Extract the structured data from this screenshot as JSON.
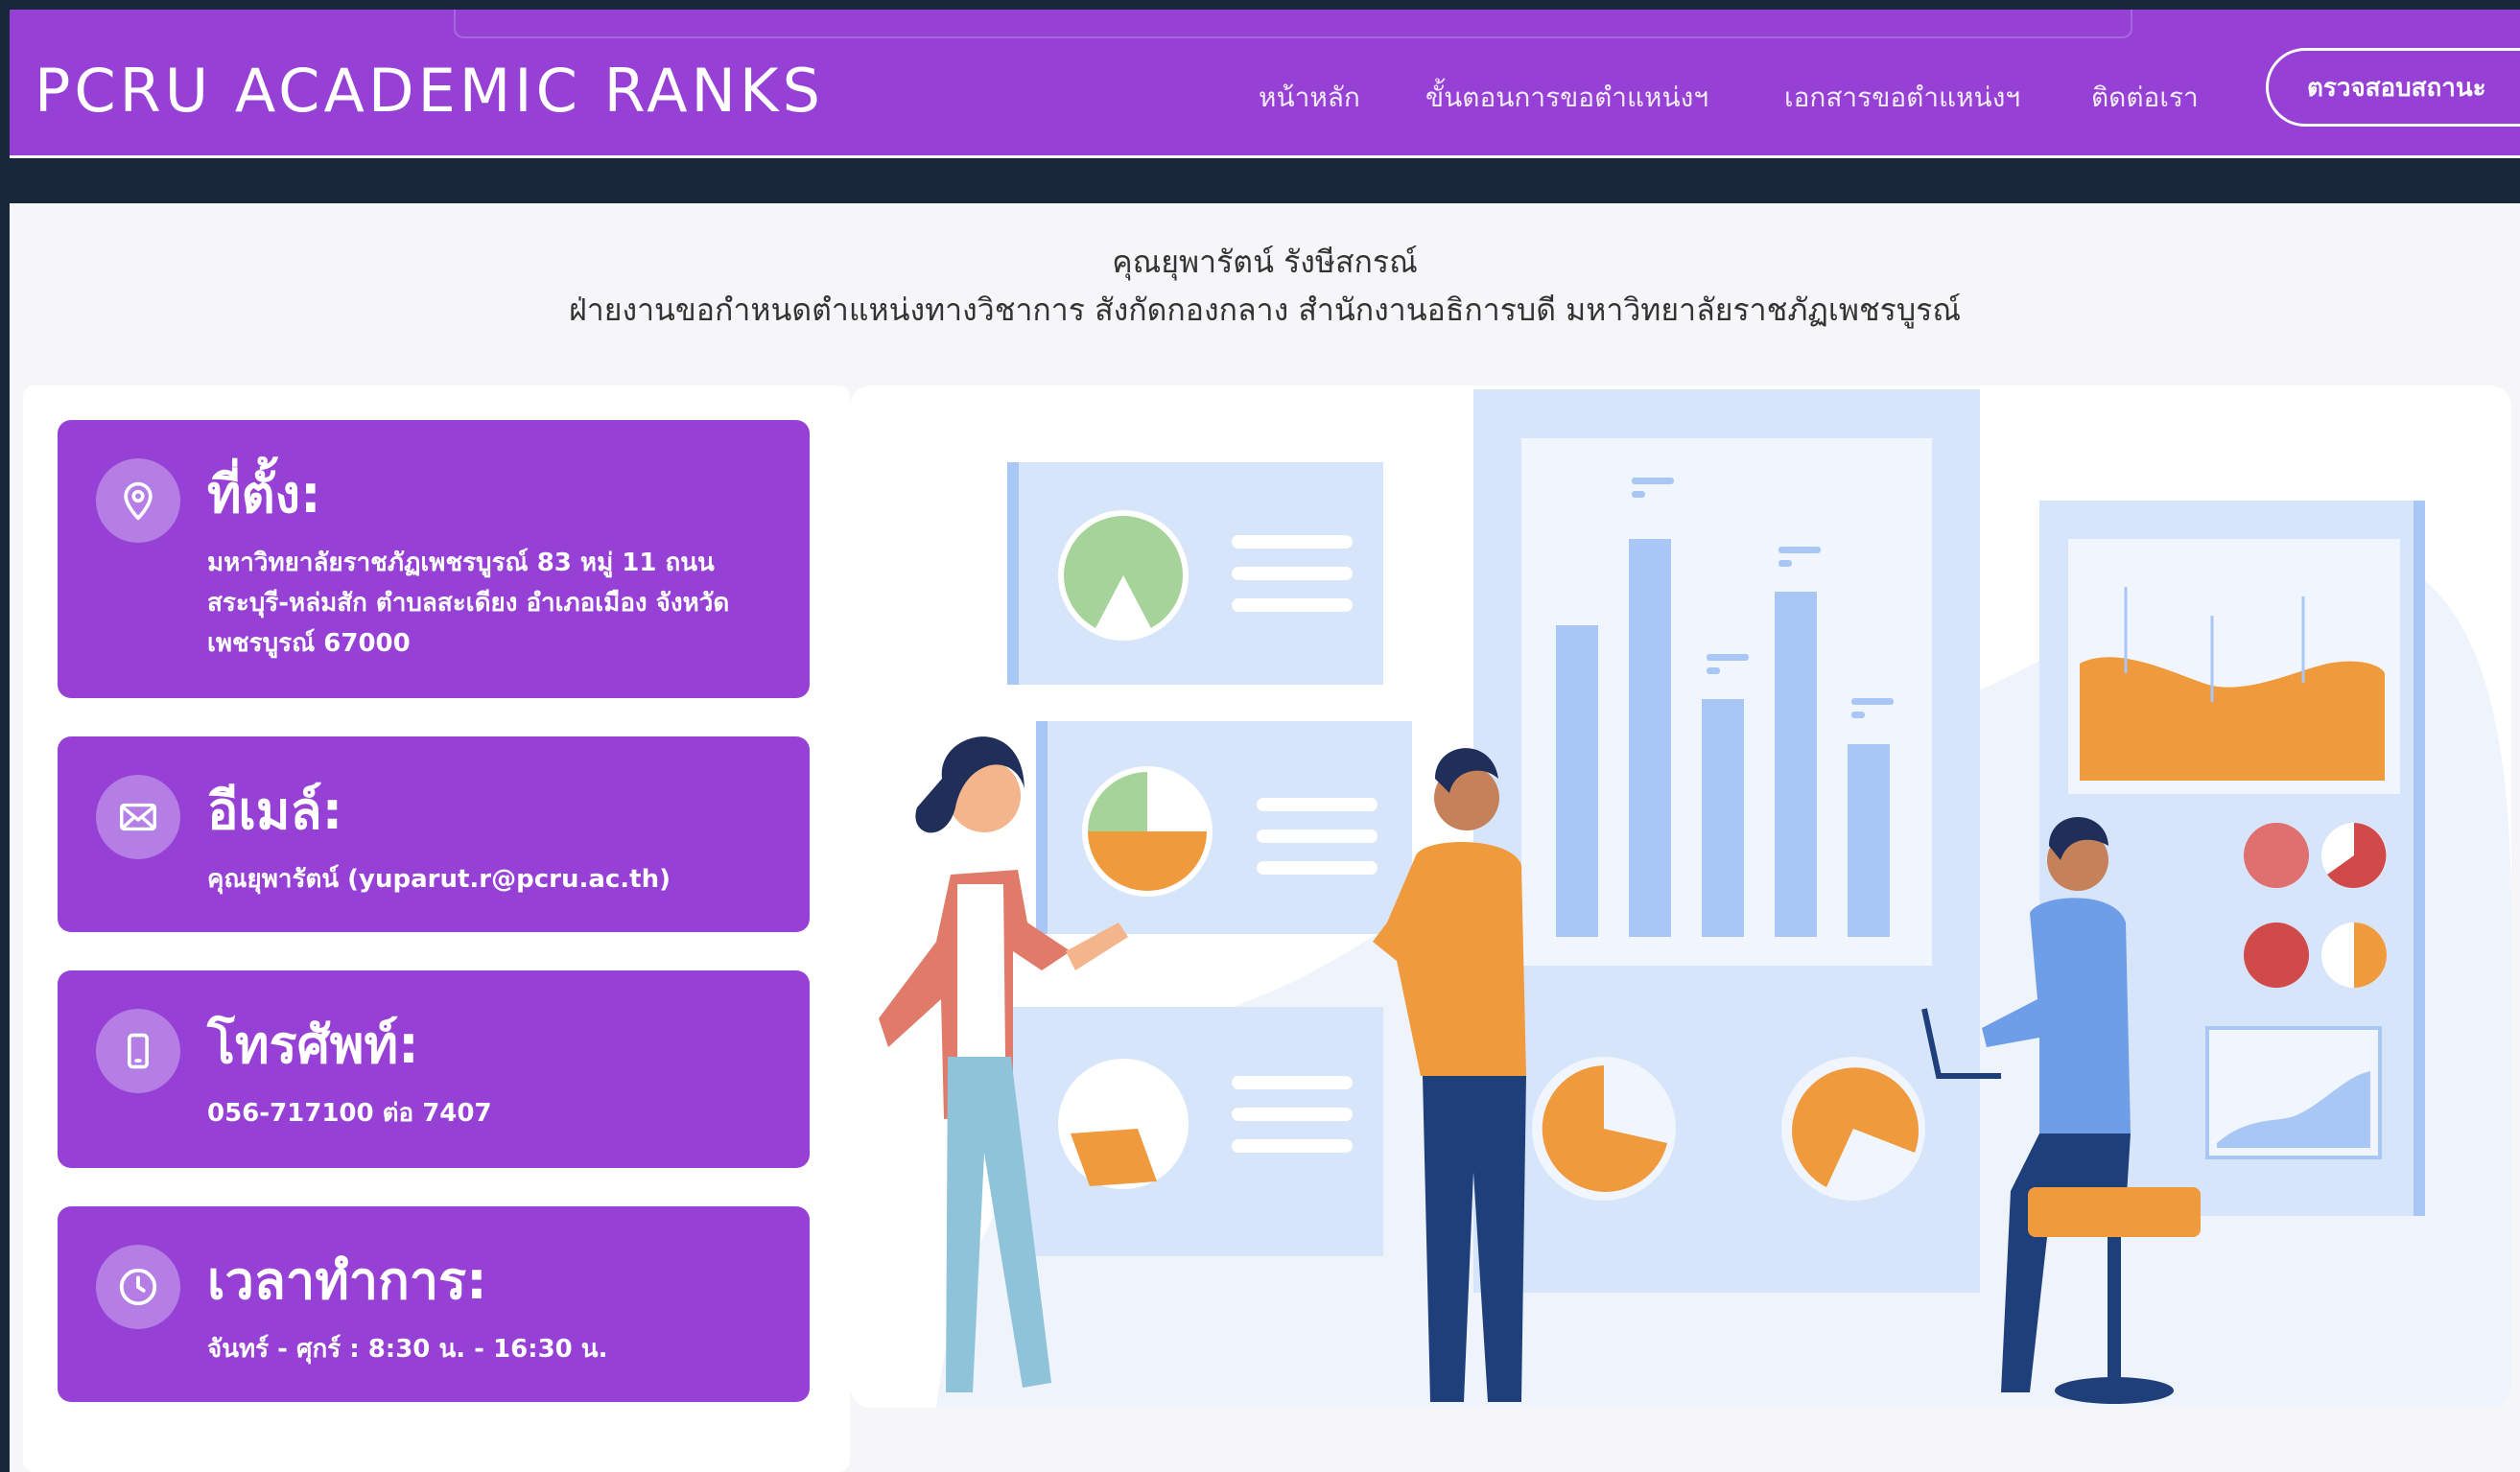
{
  "navbar": {
    "brand": "PCRU ACADEMIC RANKS",
    "links": [
      "หน้าหลัก",
      "ขั้นตอนการขอตำแหน่งฯ",
      "เอกสารขอตำแหน่งฯ",
      "ติดต่อเรา"
    ],
    "cta": "ตรวจสอบสถานะ"
  },
  "contact": {
    "name": "คุณยุพารัตน์ รังษีสกรณ์",
    "department": "ฝ่ายงานขอกำหนดตำแหน่งทางวิชาการ สังกัดกองกลาง สำนักงานอธิการบดี มหาวิทยาลัยราชภัฏเพชรบูรณ์"
  },
  "cards": {
    "location": {
      "title": "ที่ตั้ง:",
      "text": "มหาวิทยาลัยราชภัฏเพชรบูรณ์ 83 หมู่ 11 ถนนสระบุรี-หล่มสัก ตำบลสะเดียง อำเภอเมือง จังหวัดเพชรบูรณ์ 67000",
      "icon": "map-pin-icon"
    },
    "email": {
      "title": "อีเมล์:",
      "text": "คุณยุพารัตน์ (yuparut.r@pcru.ac.th)",
      "icon": "envelope-icon"
    },
    "phone": {
      "title": "โทรศัพท์:",
      "text": "056-717100 ต่อ 7407",
      "icon": "mobile-phone-icon"
    },
    "hours": {
      "title": "เวลาทำการ:",
      "text": "จันทร์ - ศุกร์ : 8:30 น. - 16:30 น.",
      "icon": "clock-icon"
    }
  },
  "colors": {
    "brand_purple": "#9640d6",
    "dark_background": "#18283a",
    "icon_circle": "#b57ee4",
    "illustration_blue": "#a9c7f5",
    "illustration_orange": "#f09a3e"
  }
}
